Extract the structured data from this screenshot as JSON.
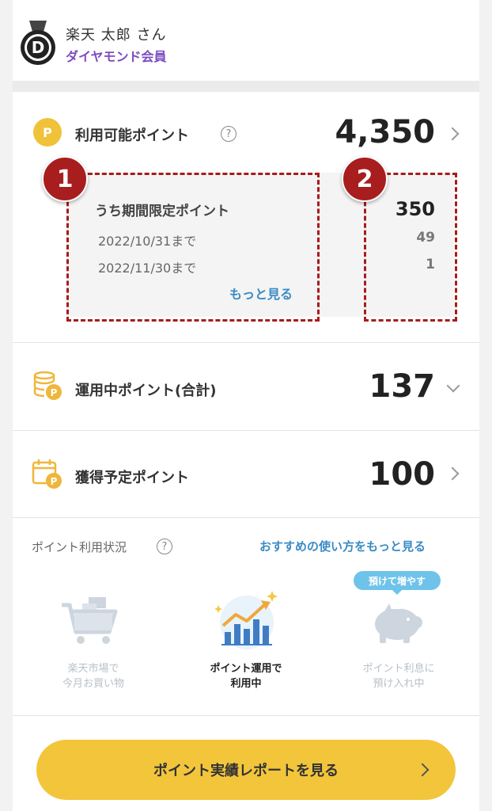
{
  "user": {
    "badge_letter": "D",
    "name": "楽天 太郎 さん",
    "rank": "ダイヤモンド会員"
  },
  "available": {
    "coin_letter": "P",
    "label": "利用可能ポイント",
    "help": "?",
    "value": "4,350",
    "limited": {
      "title": "うち期間限定ポイント",
      "total": "350",
      "rows": [
        {
          "date": "2022/10/31まで",
          "value": "49"
        },
        {
          "date": "2022/11/30まで",
          "value": "1"
        }
      ],
      "more": "もっと見る"
    }
  },
  "annotations": [
    "1",
    "2"
  ],
  "investing": {
    "label": "運用中ポイント(合計)",
    "value": "137"
  },
  "scheduled": {
    "label": "獲得予定ポイント",
    "value": "100"
  },
  "usage": {
    "title": "ポイント利用状況",
    "help": "?",
    "link": "おすすめの使い方をもっと見る",
    "tag": "預けて増やす",
    "items": [
      {
        "line1": "楽天市場で",
        "line2": "今月お買い物",
        "icon": "shopping-cart-icon",
        "active": false
      },
      {
        "line1": "ポイント運用で",
        "line2": "利用中",
        "icon": "investment-chart-icon",
        "active": true
      },
      {
        "line1": "ポイント利息に",
        "line2": "預け入れ中",
        "icon": "piggy-bank-icon",
        "active": false
      }
    ]
  },
  "report_button": "ポイント実績レポートを見る",
  "colors": {
    "accent_yellow": "#f3c53b",
    "link_blue": "#3a8bc4",
    "rank_purple": "#7c4dbf",
    "annotation_red": "#a81e1e"
  }
}
